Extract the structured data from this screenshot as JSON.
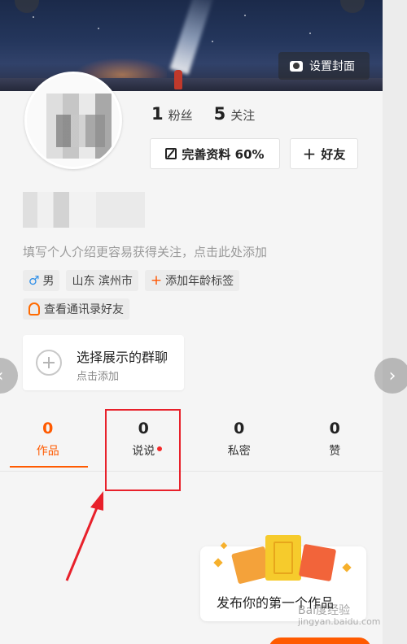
{
  "cover": {
    "set_cover_label": "设置封面"
  },
  "stats": {
    "fans_count": "1",
    "fans_label": "粉丝",
    "following_count": "5",
    "following_label": "关注"
  },
  "actions": {
    "complete_profile_label": "完善资料 60%",
    "add_friend_label": "好友"
  },
  "profile": {
    "bio_placeholder": "填写个人介绍更容易获得关注，点击此处添加",
    "tags": [
      {
        "label": "男"
      },
      {
        "label": "山东 滨州市"
      },
      {
        "label": "添加年龄标签"
      }
    ],
    "contacts_label": "查看通讯录好友"
  },
  "group_card": {
    "title": "选择展示的群聊",
    "subtitle": "点击添加"
  },
  "tabs": [
    {
      "count": "0",
      "label": "作品",
      "active": true
    },
    {
      "count": "0",
      "label": "说说",
      "has_dot": true
    },
    {
      "count": "0",
      "label": "私密"
    },
    {
      "count": "0",
      "label": "赞"
    }
  ],
  "promo": {
    "title": "发布你的第一个作品"
  },
  "watermark": {
    "line1": "Bai度经验",
    "line2": "jingyan.baidu.com"
  },
  "colors": {
    "accent": "#ff5a00",
    "annotation_red": "#e8212b"
  }
}
